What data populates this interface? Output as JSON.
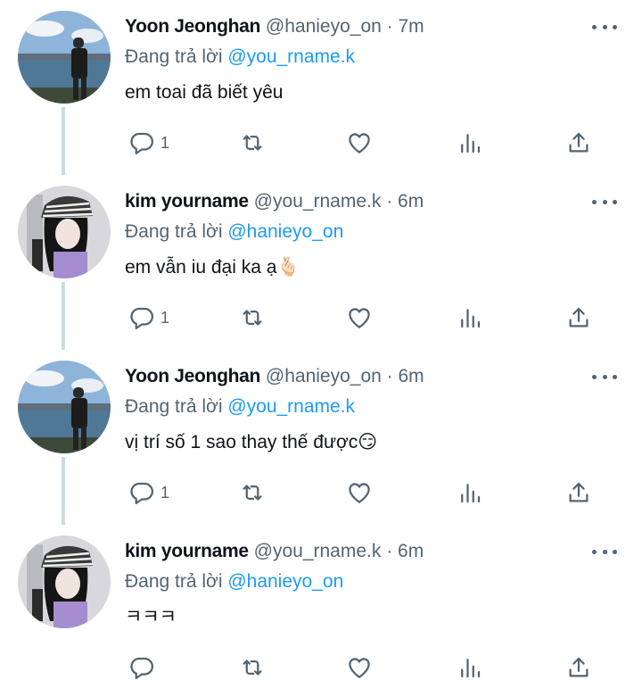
{
  "tweets": [
    {
      "name": "Yoon Jeonghan",
      "handle": "@hanieyo_on",
      "separator": "·",
      "time": "7m",
      "reply_label": "Đang trả lời",
      "reply_to": "@you_rname.k",
      "text": "em toai đã biết yêu",
      "reply_count": "1",
      "avatar": "avatar-photo-lake-person"
    },
    {
      "name": "kim yourname",
      "handle": "@you_rname.k",
      "separator": "·",
      "time": "6m",
      "reply_label": "Đang trả lời",
      "reply_to": "@hanieyo_on",
      "text": "em vẫn iu đại ka ạ🫰🏻",
      "reply_count": "1",
      "avatar": "avatar-photo-striped-hat"
    },
    {
      "name": "Yoon Jeonghan",
      "handle": "@hanieyo_on",
      "separator": "·",
      "time": "6m",
      "reply_label": "Đang trả lời",
      "reply_to": "@you_rname.k",
      "text": "vị trí số 1 sao thay thế được😏",
      "reply_count": "1",
      "avatar": "avatar-photo-lake-person"
    },
    {
      "name": "kim yourname",
      "handle": "@you_rname.k",
      "separator": "·",
      "time": "6m",
      "reply_label": "Đang trả lời",
      "reply_to": "@hanieyo_on",
      "text": "ㅋㅋㅋ",
      "reply_count": "",
      "avatar": "avatar-photo-striped-hat"
    }
  ],
  "icons": {
    "reply": "reply-icon",
    "retweet": "retweet-icon",
    "like": "heart-icon",
    "views": "views-icon",
    "share": "share-icon",
    "more": "more-icon"
  },
  "colors": {
    "text": "#0f1419",
    "secondary": "#536471",
    "link": "#1d9bf0",
    "thread_line": "#cfd9de"
  }
}
